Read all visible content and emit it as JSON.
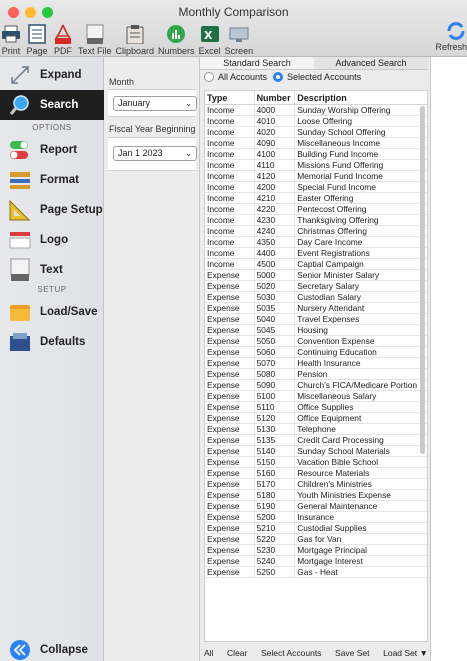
{
  "window": {
    "title": "Monthly Comparison"
  },
  "toolbar": {
    "items": [
      {
        "label": "Print",
        "icon": "printer-icon"
      },
      {
        "label": "Page",
        "icon": "page-icon"
      },
      {
        "label": "PDF",
        "icon": "pdf-icon"
      },
      {
        "label": "Text File",
        "icon": "text-file-icon"
      },
      {
        "label": "Clipboard",
        "icon": "clipboard-icon"
      },
      {
        "label": "Numbers",
        "icon": "numbers-icon"
      },
      {
        "label": "Excel",
        "icon": "excel-icon"
      },
      {
        "label": "Screen",
        "icon": "screen-icon"
      }
    ],
    "refresh_label": "Refresh"
  },
  "sidebar": {
    "expand": "Expand",
    "search": "Search",
    "options_header": "OPTIONS",
    "report": "Report",
    "format": "Format",
    "page_setup": "Page Setup",
    "logo": "Logo",
    "text": "Text",
    "setup_header": "SETUP",
    "load_save": "Load/Save",
    "defaults": "Defaults",
    "collapse": "Collapse"
  },
  "options": {
    "month_label": "Month",
    "month_value": "January",
    "fiscal_label": "Fiscal Year Beginning",
    "fiscal_value": "Jan 1 2023"
  },
  "tabs": {
    "standard": "Standard Search",
    "advanced": "Advanced Search"
  },
  "radios": {
    "all": "All Accounts",
    "selected": "Selected Accounts"
  },
  "table": {
    "headers": [
      "Type",
      "Number",
      "Description"
    ],
    "rows": [
      [
        "Income",
        "4000",
        "Sunday Worship Offering"
      ],
      [
        "Income",
        "4010",
        "Loose Offering"
      ],
      [
        "Income",
        "4020",
        "Sunday School Offering"
      ],
      [
        "Income",
        "4090",
        "Miscellaneous Income"
      ],
      [
        "Income",
        "4100",
        "Building Fund Income"
      ],
      [
        "Income",
        "4110",
        "Missions Fund Offering"
      ],
      [
        "Income",
        "4120",
        "Memorial Fund Income"
      ],
      [
        "Income",
        "4200",
        "Special Fund Income"
      ],
      [
        "Income",
        "4210",
        "Easter Offering"
      ],
      [
        "Income",
        "4220",
        "Pentecost Offering"
      ],
      [
        "Income",
        "4230",
        "Thanksgiving Offering"
      ],
      [
        "Income",
        "4240",
        "Christmas Offering"
      ],
      [
        "Income",
        "4350",
        "Day Care Income"
      ],
      [
        "Income",
        "4400",
        "Event Registrations"
      ],
      [
        "Income",
        "4500",
        "Captial Campaign"
      ],
      [
        "Expense",
        "5000",
        "Senior Minister Salary"
      ],
      [
        "Expense",
        "5020",
        "Secretary Salary"
      ],
      [
        "Expense",
        "5030",
        "Custodian Salary"
      ],
      [
        "Expense",
        "5035",
        "Nursery Attendant"
      ],
      [
        "Expense",
        "5040",
        "Travel Expenses"
      ],
      [
        "Expense",
        "5045",
        "Housing"
      ],
      [
        "Expense",
        "5050",
        "Convention Expense"
      ],
      [
        "Expense",
        "5060",
        "Continuing Education"
      ],
      [
        "Expense",
        "5070",
        "Health Insurance"
      ],
      [
        "Expense",
        "5080",
        "Pension"
      ],
      [
        "Expense",
        "5090",
        "Church's FICA/Medicare Portion"
      ],
      [
        "Expense",
        "5100",
        "Miscellaneous Salary"
      ],
      [
        "Expense",
        "5110",
        "Office Supplies"
      ],
      [
        "Expense",
        "5120",
        "Office Equipment"
      ],
      [
        "Expense",
        "5130",
        "Telephone"
      ],
      [
        "Expense",
        "5135",
        "Credit Card Processing"
      ],
      [
        "Expense",
        "5140",
        "Sunday School Materials"
      ],
      [
        "Expense",
        "5150",
        "Vacation Bible School"
      ],
      [
        "Expense",
        "5160",
        "Resource Materials"
      ],
      [
        "Expense",
        "5170",
        "Children's Ministries"
      ],
      [
        "Expense",
        "5180",
        "Youth Ministries Expense"
      ],
      [
        "Expense",
        "5190",
        "General Maintenance"
      ],
      [
        "Expense",
        "5200",
        "Insurance"
      ],
      [
        "Expense",
        "5210",
        "Custodial Supplies"
      ],
      [
        "Expense",
        "5220",
        "Gas for Van"
      ],
      [
        "Expense",
        "5230",
        "Mortgage Principal"
      ],
      [
        "Expense",
        "5240",
        "Mortgage Interest"
      ],
      [
        "Expense",
        "5250",
        "Gas - Heat"
      ]
    ]
  },
  "bottom": {
    "all": "All",
    "clear": "Clear",
    "select_accounts": "Select Accounts",
    "save_set": "Save Set",
    "load_set": "Load Set"
  },
  "colors": {
    "accent": "#2b82f5",
    "active_sidebar": "#1f1f1f"
  }
}
